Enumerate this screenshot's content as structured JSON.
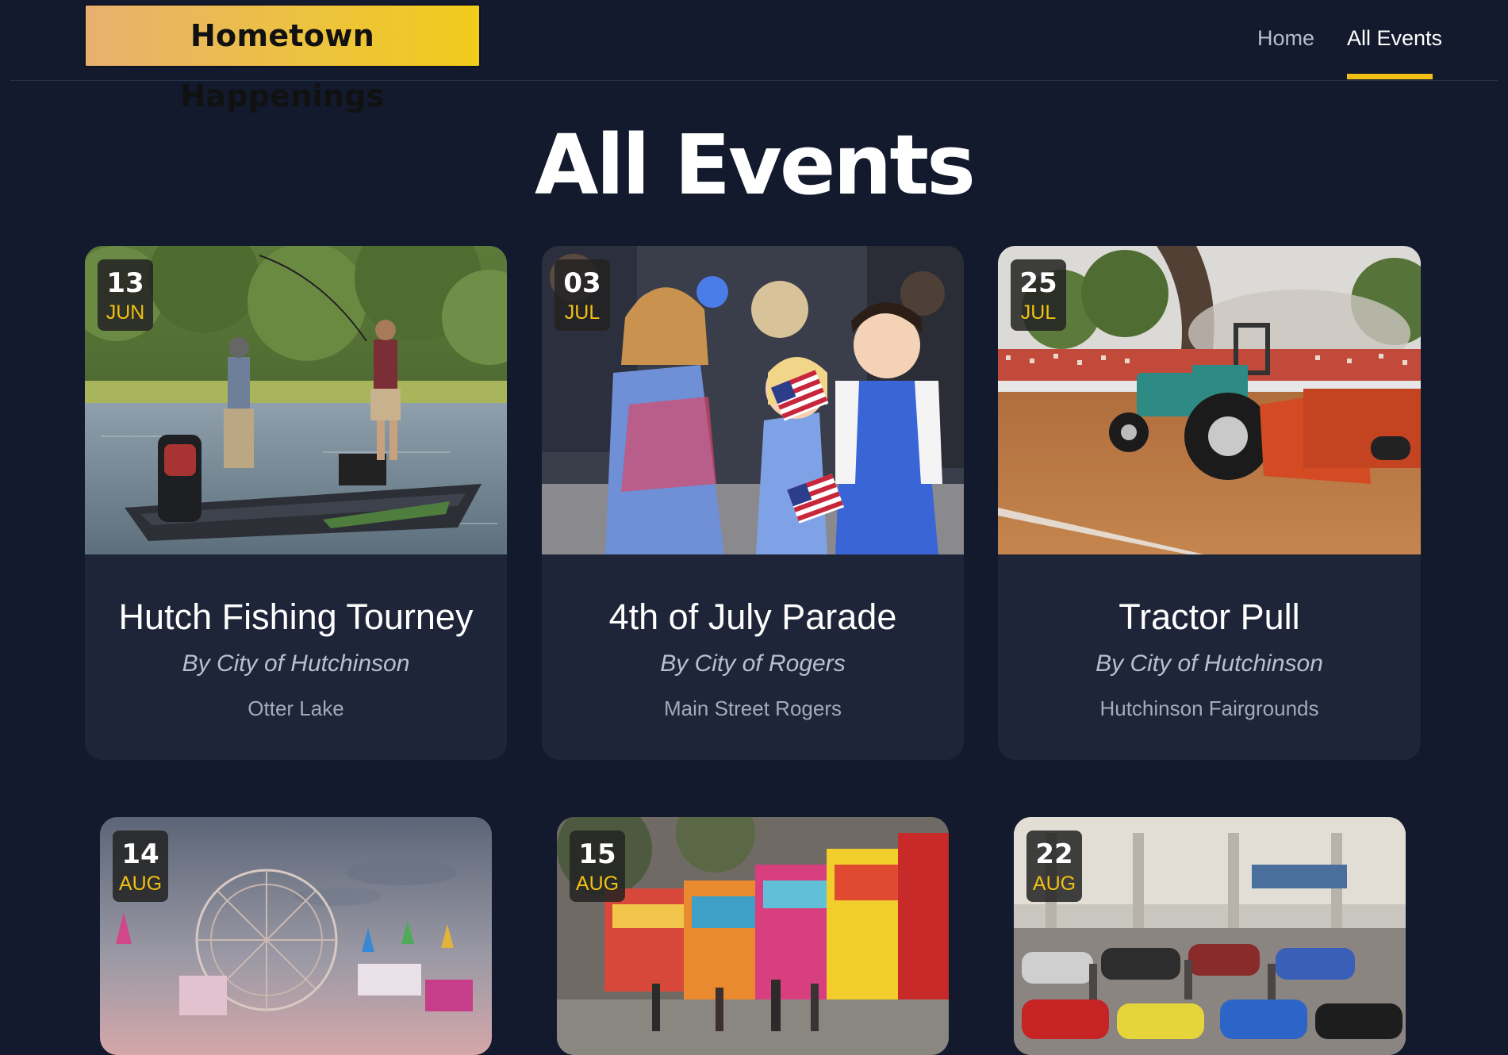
{
  "header": {
    "logo_text": "Hometown Happenings",
    "nav": [
      {
        "label": "Home",
        "active": false
      },
      {
        "label": "All Events",
        "active": true
      }
    ],
    "accent_color": "#f2c014"
  },
  "page_title": "All Events",
  "events": [
    {
      "day": "13",
      "month": "JUN",
      "title": "Hutch Fishing Tourney",
      "organizer": "By City of Hutchinson",
      "location": "Otter Lake",
      "image": "bass-fishing-boat-photo"
    },
    {
      "day": "03",
      "month": "JUL",
      "title": "4th of July Parade",
      "organizer": "By City of Rogers",
      "location": "Main Street Rogers",
      "image": "parade-children-flags-photo"
    },
    {
      "day": "25",
      "month": "JUL",
      "title": "Tractor Pull",
      "organizer": "By City of Hutchinson",
      "location": "Hutchinson Fairgrounds",
      "image": "tractor-pull-photo"
    },
    {
      "day": "14",
      "month": "AUG",
      "image": "ferris-wheel-fair-photo"
    },
    {
      "day": "15",
      "month": "AUG",
      "image": "food-trucks-photo"
    },
    {
      "day": "22",
      "month": "AUG",
      "image": "car-show-photo"
    }
  ]
}
